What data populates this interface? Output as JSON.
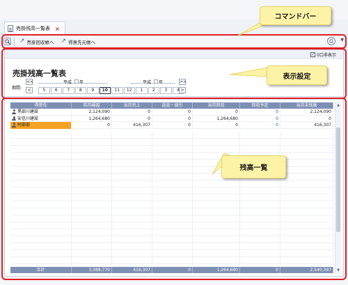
{
  "tab": {
    "title": "売掛残高一覧表",
    "close_label": "×"
  },
  "command_bar": {
    "search_icon": "search-icon",
    "buttons": [
      {
        "label": "売掛回収帳へ",
        "icon": "arrow-up-right-icon"
      },
      {
        "label": "得意先元帳へ",
        "icon": "arrow-up-right-icon"
      }
    ],
    "print_icon": "printer-icon",
    "dropdown_icon": "chevron-down-icon"
  },
  "settings": {
    "checkbox_label": "0口非表示",
    "checkbox_checked": true,
    "page_title": "売掛残高一覧表",
    "period_label": "期間:",
    "year_labels": [
      {
        "era": "平成",
        "suffix": "年"
      },
      {
        "era": "平成",
        "suffix": "年"
      }
    ],
    "nav_prev_year": "<<",
    "nav_prev": "<",
    "nav_next": ">",
    "nav_next_year": ">>",
    "months": [
      "5",
      "6",
      "7",
      "8",
      "9",
      "10",
      "11",
      "12",
      "1",
      "2",
      "3",
      "4"
    ],
    "selected_month": "10"
  },
  "grid": {
    "columns": [
      "得意先",
      "前月繰越",
      "当月売上",
      "返品・値引",
      "当月回収",
      "回収予定",
      "当月末残高"
    ],
    "rows": [
      {
        "name": "黒部川建設",
        "prev": "2,124,090",
        "sales": "0",
        "returns": "0",
        "collected": "0",
        "planned": "0",
        "balance": "2,124,090",
        "selected": false
      },
      {
        "name": "安信川建設",
        "prev": "1,264,680",
        "sales": "0",
        "returns": "0",
        "collected": "1,264,680",
        "planned": "0",
        "balance": "0",
        "selected": false
      },
      {
        "name": "阿部部",
        "prev": "0",
        "sales": "416,307",
        "returns": "0",
        "collected": "0",
        "planned": "0",
        "balance": "416,307",
        "selected": true
      }
    ],
    "totals": {
      "label": "合計",
      "prev": "3,388,770",
      "sales": "416,307",
      "returns": "0",
      "collected": "1,264,680",
      "planned": "0",
      "balance": "2,540,397"
    }
  },
  "callouts": {
    "command_bar": "コマンドバー",
    "settings": "表示設定",
    "grid": "残高一覧"
  },
  "colors": {
    "frame": "#e31b23",
    "callout_bg": "#fdf3a7",
    "header_bg": "#7e8fb4",
    "selected_row": "#f4a223"
  }
}
